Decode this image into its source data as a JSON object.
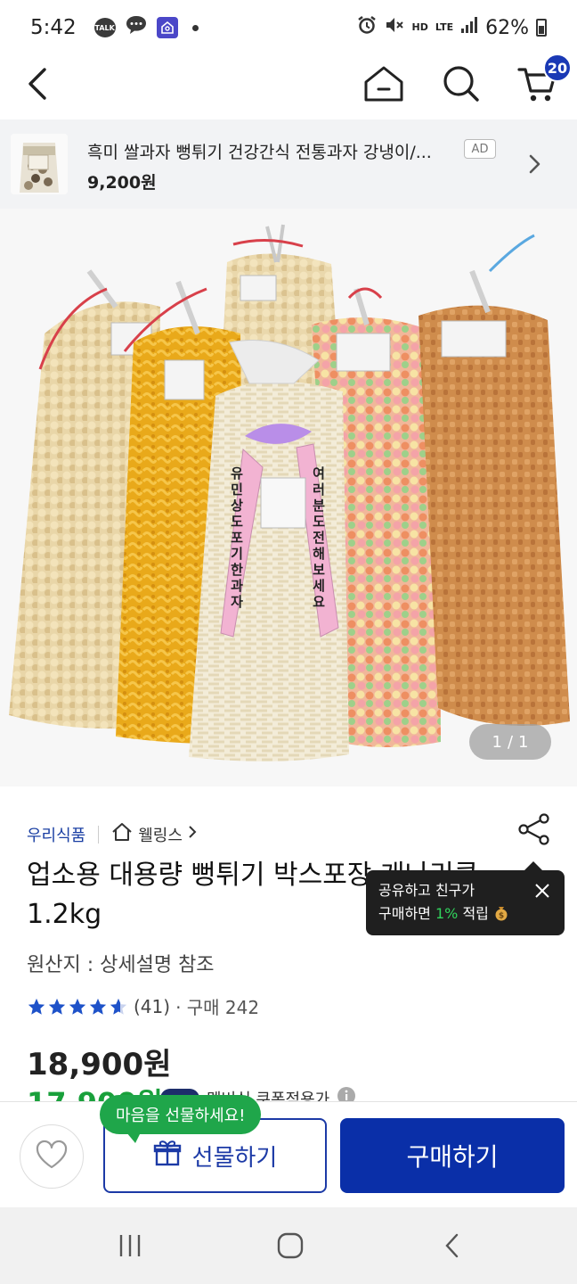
{
  "status_bar": {
    "time": "5:42",
    "icons": [
      "talk-icon",
      "message-icon",
      "app-notification-icon",
      "dot-icon"
    ],
    "talk_label": "TALK",
    "right_icons": [
      "alarm-icon",
      "mute-icon",
      "hd-voice-icon",
      "lte-icon",
      "signal-icon",
      "battery-icon"
    ],
    "hd_label": "HD",
    "lte_label": "LTE",
    "battery": "62%"
  },
  "app_bar": {
    "icons": [
      "back-arrow-icon",
      "home-icon",
      "search-icon",
      "cart-icon"
    ],
    "cart_count": "20"
  },
  "ad": {
    "title": "흑미 쌀과자 뻥튀기 건강간식 전통과자 강냉이/...",
    "price": "9,200원",
    "badge": "AD"
  },
  "gallery": {
    "counter_current": "1",
    "counter_sep": "/",
    "counter_total": "1",
    "ribbon_left": "유민상도 포기한 과자",
    "ribbon_right": "여러분 도전해보세요"
  },
  "product": {
    "brand": "우리식품",
    "store": "웰링스",
    "title": "업소용 대용량 뻥튀기 박스포장 개나리콘 1.2kg",
    "origin": "원산지 : 상세설명 참조",
    "rating_stars": 4.5,
    "review_count": "(41)",
    "purchase_label": "· 구매 242",
    "price_original": "18,900원",
    "price_sale": "17,900원",
    "coupon_text": "멤버십 쿠폰적용가"
  },
  "share_tooltip": {
    "line1": "공유하고 친구가",
    "line2_prefix": "구매하면 ",
    "line2_pct": "1%",
    "line2_suffix": " 적립"
  },
  "actions": {
    "gift_bubble": "마음을 선물하세요!",
    "gift_label": "선물하기",
    "buy_label": "구매하기"
  },
  "colors": {
    "accent": "#0a2fa8",
    "sale_green": "#19a03b",
    "brand_blue": "#1a3fa3"
  }
}
